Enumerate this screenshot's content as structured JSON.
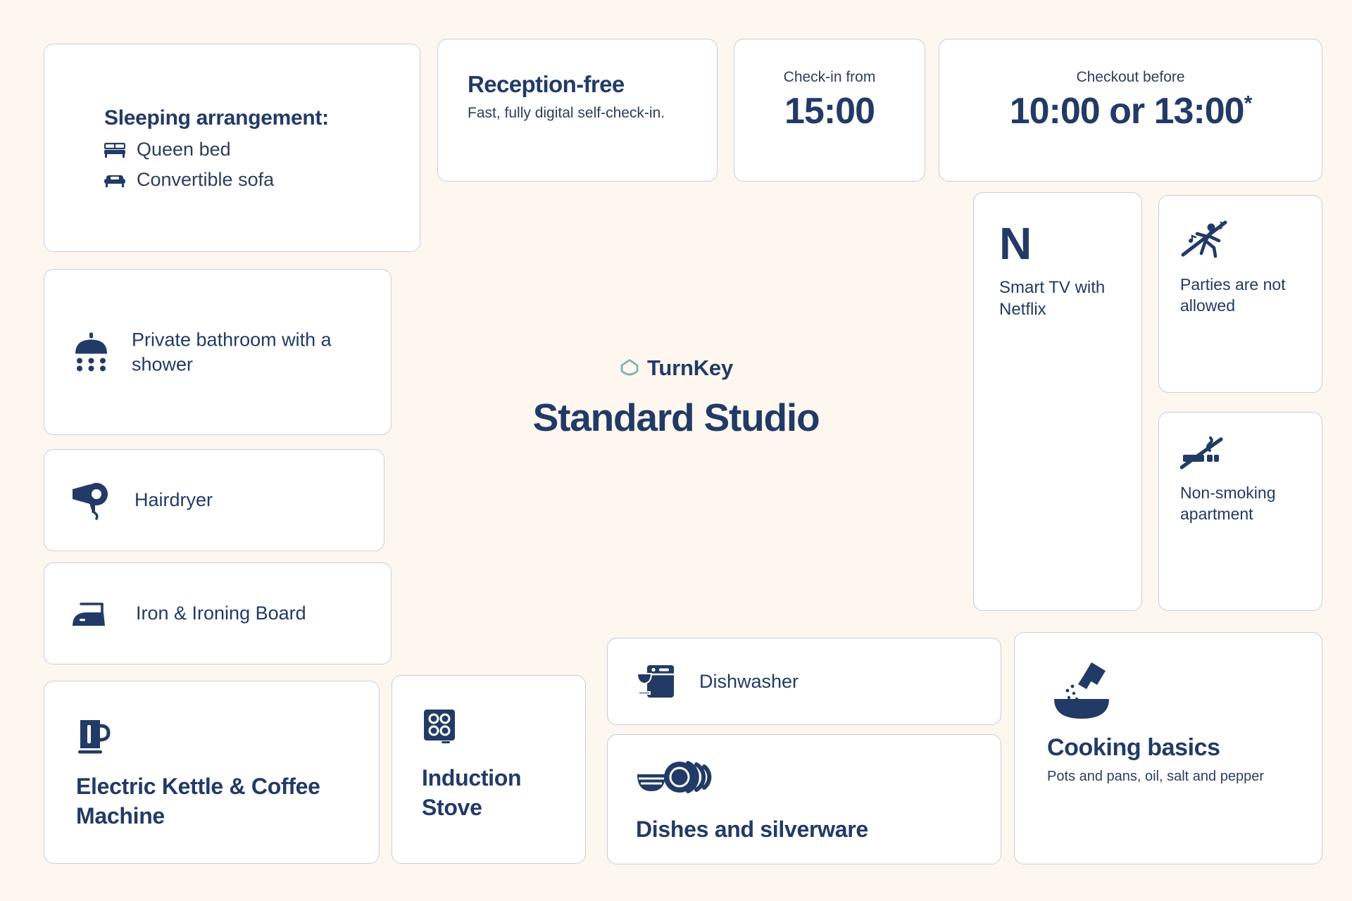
{
  "brand": {
    "logo_icon": "turnkey-hexagon-logo",
    "name": "TurnKey",
    "title": "Standard Studio",
    "logo_color": "#7FB3B0",
    "accent_color": "#223A66",
    "background_color": "#FDF7F0",
    "card_background": "#FFFFFF",
    "card_border_color": "#C9CED8"
  },
  "sleeping": {
    "title": "Sleeping arrangement:",
    "items": [
      {
        "icon": "bed-icon",
        "label": "Queen bed"
      },
      {
        "icon": "sofa-icon",
        "label": "Convertible sofa"
      }
    ]
  },
  "reception": {
    "title": "Reception-free",
    "subtitle": "Fast, fully digital self-check-in."
  },
  "checkin": {
    "label": "Check-in from",
    "time": "15:00"
  },
  "checkout": {
    "label": "Checkout before",
    "time": "10:00 or 13:00",
    "asterisk": "*"
  },
  "bathroom": {
    "icon": "shower-icon",
    "label": "Private bathroom with a shower"
  },
  "hairdryer": {
    "icon": "hairdryer-icon",
    "label": "Hairdryer"
  },
  "iron": {
    "icon": "iron-icon",
    "label": "Iron & Ironing Board"
  },
  "kettle": {
    "icon": "electric-kettle-icon",
    "label": "Electric Kettle & Coffee Machine"
  },
  "stove": {
    "icon": "induction-stove-icon",
    "label": "Induction Stove"
  },
  "dishwasher": {
    "icon": "dishwasher-icon",
    "label": "Dishwasher"
  },
  "dishes": {
    "icon": "dishes-icon",
    "label": "Dishes and silverware"
  },
  "smart_tv": {
    "icon": "netflix-n-icon",
    "glyph": "N",
    "label": "Smart TV with Netflix"
  },
  "no_parties": {
    "icon": "no-parties-icon",
    "label": "Parties are not allowed"
  },
  "no_smoking": {
    "icon": "no-smoking-icon",
    "label": "Non-smoking apartment"
  },
  "cooking": {
    "icon": "seasoning-bowl-icon",
    "title": "Cooking basics",
    "subtitle": "Pots and pans, oil, salt and pepper"
  }
}
